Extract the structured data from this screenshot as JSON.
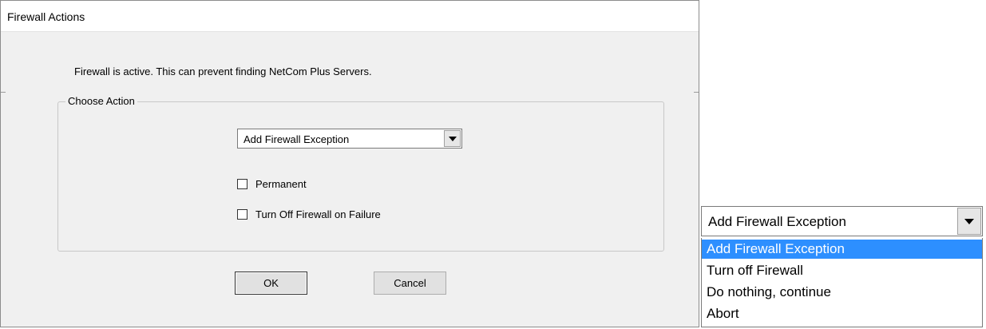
{
  "dialog": {
    "title": "Firewall Actions",
    "message": "Firewall is active. This can prevent finding NetCom Plus Servers.",
    "group_label": "Choose Action",
    "action_select": {
      "selected": "Add Firewall Exception"
    },
    "checkboxes": [
      {
        "label": "Permanent",
        "checked": false
      },
      {
        "label": "Turn Off Firewall on Failure",
        "checked": false
      }
    ],
    "ok_label": "OK",
    "cancel_label": "Cancel"
  },
  "dropdown_expanded": {
    "selected": "Add Firewall Exception",
    "options": [
      "Add Firewall Exception",
      "Turn off Firewall",
      "Do nothing, continue",
      "Abort"
    ],
    "highlighted_index": 0
  },
  "colors": {
    "highlight": "#2d8fff",
    "dialog_bg": "#f0f0f0"
  }
}
